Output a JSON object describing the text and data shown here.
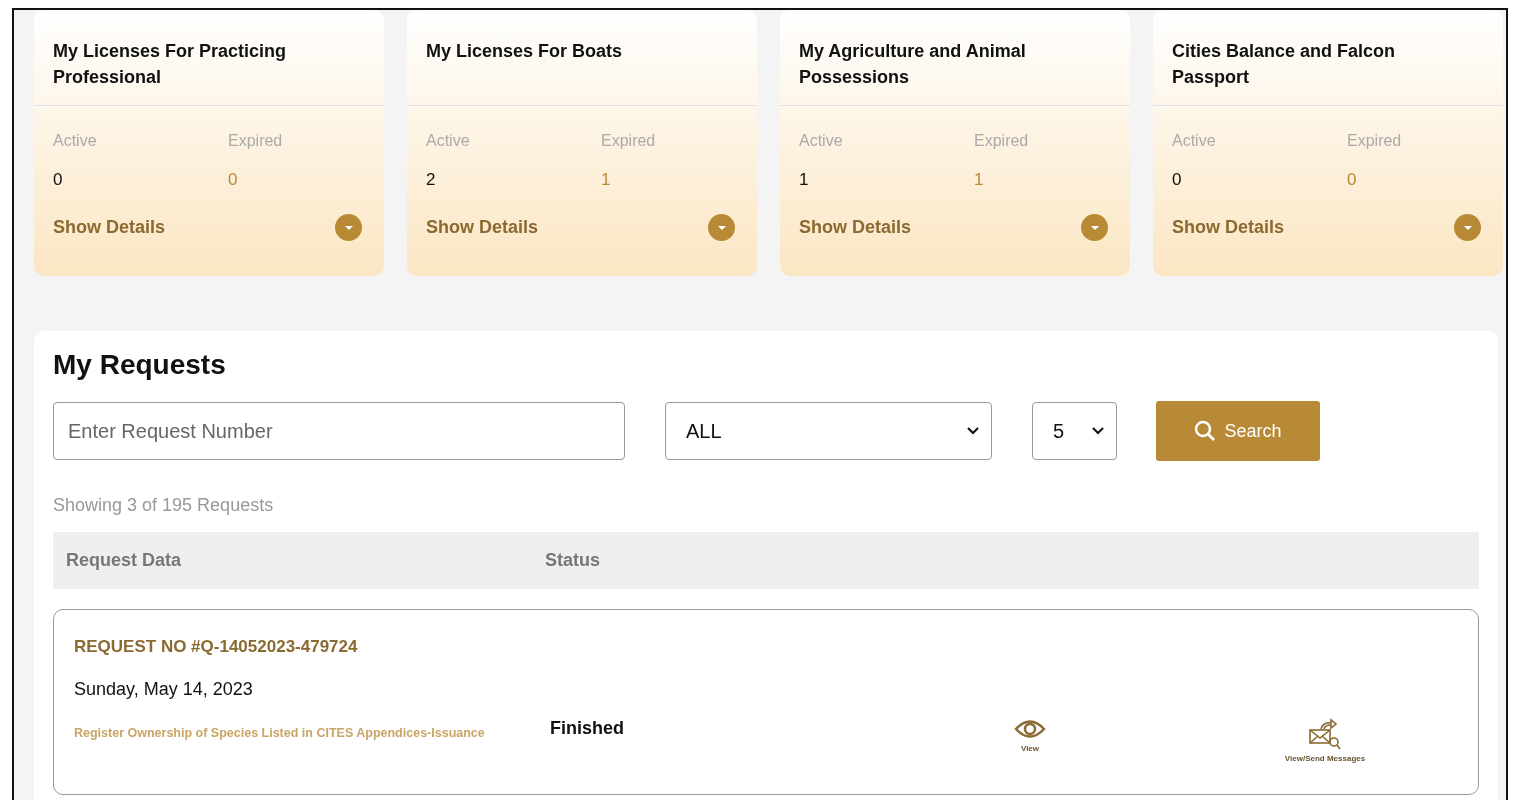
{
  "cards": [
    {
      "title": "My Licenses For Practicing Professional",
      "active_label": "Active",
      "active_value": "0",
      "expired_label": "Expired",
      "expired_value": "0",
      "details_label": "Show Details"
    },
    {
      "title": "My Licenses For Boats",
      "active_label": "Active",
      "active_value": "2",
      "expired_label": "Expired",
      "expired_value": "1",
      "details_label": "Show Details"
    },
    {
      "title": "My Agriculture and Animal Possessions",
      "active_label": "Active",
      "active_value": "1",
      "expired_label": "Expired",
      "expired_value": "1",
      "details_label": "Show Details"
    },
    {
      "title": "Cities Balance and Falcon Passport",
      "active_label": "Active",
      "active_value": "0",
      "expired_label": "Expired",
      "expired_value": "0",
      "details_label": "Show Details"
    }
  ],
  "requests": {
    "title": "My Requests",
    "search_field": {
      "placeholder": "Enter Request Number"
    },
    "status_filter": "ALL",
    "page_size": "5",
    "search_button": "Search",
    "showing": "Showing 3 of 195 Requests",
    "columns": [
      "Request Data",
      "Status"
    ],
    "rows": [
      {
        "number": "REQUEST NO #Q-14052023-479724",
        "date": "Sunday, May 14, 2023",
        "service": "Register Ownership of Species Listed in CITES Appendices-Issuance",
        "status": "Finished",
        "actions": [
          {
            "kind": "view",
            "label": "View"
          },
          {
            "kind": "messages",
            "label": "View/Send Messages"
          }
        ]
      }
    ]
  }
}
